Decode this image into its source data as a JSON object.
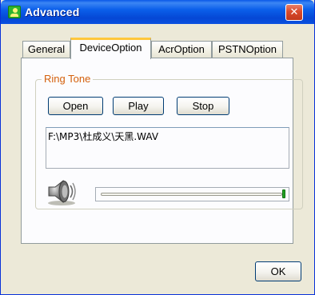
{
  "window": {
    "title": "Advanced",
    "close_glyph": "✕",
    "icon": "app-icon"
  },
  "tabs": [
    {
      "label": "General",
      "active": false
    },
    {
      "label": "DeviceOption",
      "active": true
    },
    {
      "label": "AcrOption",
      "active": false
    },
    {
      "label": "PSTNOption",
      "active": false
    }
  ],
  "ring_tone": {
    "group_label": "Ring Tone",
    "open_label": "Open",
    "play_label": "Play",
    "stop_label": "Stop",
    "file_path": "F:\\MP3\\杜成义\\天黑.WAV",
    "volume_icon": "speaker-icon",
    "volume_level": 1.0
  },
  "footer": {
    "ok_label": "OK"
  },
  "colors": {
    "titlebar": "#0b5fea",
    "group_label": "#d4600c",
    "active_tab_highlight": "#ffc73c",
    "slider_thumb": "#21a121"
  }
}
